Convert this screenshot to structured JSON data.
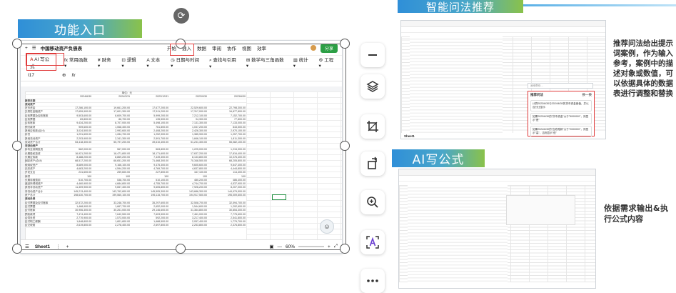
{
  "banners": {
    "function_entry": "功能入口",
    "smart_recommend": "智能问法推荐",
    "ai_formula": "AI写公式"
  },
  "main_window": {
    "title_plus": "+",
    "doc_title": "中国移动资产负债表",
    "menu_tabs": [
      "开始",
      "插入",
      "数据",
      "审阅",
      "协作",
      "视图",
      "效率"
    ],
    "highlighted_tab_index": 3,
    "share_label": "分享",
    "toolbar": {
      "ai_formula": "AI 写公式",
      "common_functions": "常用函数",
      "finance": "财务",
      "logic": "逻辑",
      "text": "文本",
      "datetime": "日期与时间",
      "lookup": "查找与引用",
      "math": "数学与三角函数",
      "stats": "统计",
      "engineering": "工程"
    },
    "cell_ref": "I17",
    "fx_label": "fx",
    "table": {
      "unit": "单位：元",
      "headers": [
        "",
        "2024/6/30",
        "2024/3/31",
        "2023/12/31",
        "2023/9/30",
        "2023/6/30"
      ],
      "rows": [
        [
          "报表日期",
          "",
          "",
          "",
          "",
          ""
        ],
        [
          "流动资产",
          "",
          "",
          "",
          "",
          ""
        ],
        [
          "货币资金",
          "17,286,100.00",
          "19,661,200.00",
          "17,677,200.00",
          "22,529,600.00",
          "22,798,300.00"
        ],
        [
          "交易性金融资产",
          "17,659,900.00",
          "17,601,300.00",
          "17,511,200.00",
          "17,317,000.00",
          "16,877,800.00"
        ],
        [
          "应收票据及应收账款",
          "9,503,600.00",
          "8,609,700.00",
          "5,999,200.00",
          "7,212,100.00",
          "7,152,700.00"
        ],
        [
          "应收票据",
          "69,800.00",
          "86,700.00",
          "135,500.00",
          "94,300.00",
          "77,800.00"
        ],
        [
          "应收账款",
          "9,434,200.00",
          "8,707,000.00",
          "5,498,100.00",
          "7,131,300.00",
          "7,133,000.00"
        ],
        [
          "预付款项",
          "909,600.00",
          "1,068,400.00",
          "761,800.00",
          "1,037,200.00",
          "843,500.00"
        ],
        [
          "其他应收款(合计)",
          "3,024,500.00",
          "2,993,600.00",
          "2,408,200.00",
          "2,426,300.00",
          "2,970,100.00"
        ],
        [
          "存货",
          "1,291,600.00",
          "1,284,700.00",
          "1,252,900.00",
          "1,385,900.00",
          "1,257,700.00"
        ],
        [
          "其他流动资产",
          "2,203,900.00",
          "2,341,300.00",
          "2,591,700.00",
          "1,846,100.00",
          "1,811,300.00"
        ],
        [
          "流动资产合计",
          "53,418,300.00",
          "55,797,200.00",
          "49,610,400.00",
          "51,231,300.00",
          "55,082,100.00"
        ],
        [
          "非流动资产",
          "",
          "",
          "",
          "",
          ""
        ],
        [
          "持有至到期投资",
          "582,000.00",
          "567,000.00",
          "563,800.00",
          "1,225,000.00",
          "1,215,300.00"
        ],
        [
          "长期股权投资",
          "16,921,200.00",
          "18,471,800.00",
          "18,171,600.00",
          "17,637,200.00",
          "17,816,400.00"
        ],
        [
          "长期应收款",
          "8,488,200.00",
          "8,869,200.00",
          "7,449,300.00",
          "8,133,800.00",
          "10,076,400.00"
        ],
        [
          "固定资产(合计)",
          "68,517,200.00",
          "68,651,200.00",
          "71,468,300.00",
          "70,348,500.00",
          "68,205,800.00"
        ],
        [
          "使用权资产",
          "8,689,000.00",
          "9,166,100.00",
          "9,475,300.00",
          "9,605,600.00",
          "9,647,400.00"
        ],
        [
          "无形资产",
          "4,683,200.00",
          "4,594,200.00",
          "4,769,700.00",
          "4,637,800.00",
          "4,444,800.00"
        ],
        [
          "开发支出",
          "231,600.00",
          "259,600.00",
          "227,800.00",
          "167,100.00",
          "114,400.00"
        ],
        [
          "商誉",
          "100",
          "100",
          "100",
          "100",
          "100"
        ],
        [
          "长期待摊费用",
          "510,700.00",
          "538,700.00",
          "510,100.00",
          "480,200.00",
          "486,400.00"
        ],
        [
          "递延所得税资产",
          "4,460,900.00",
          "4,684,800.00",
          "4,755,700.00",
          "4,744,700.00",
          "4,537,900.00"
        ],
        [
          "其他非流动资产",
          "11,309,900.00",
          "9,657,400.00",
          "9,605,800.00",
          "7,926,200.00",
          "8,207,000.00"
        ],
        [
          "非流动资产合计",
          "145,213,400.00",
          "143,762,800.00",
          "145,505,300.00",
          "143,686,300.00",
          "144,979,500.00"
        ],
        [
          "资产总计",
          "198,630,700.00",
          "199,560,100.00",
          "195,115,700.00",
          "194,917,500.00",
          "195,009,600.00"
        ],
        [
          "流动负债",
          "",
          "",
          "",
          "",
          ""
        ],
        [
          "应付票据及应付账款",
          "32,572,200.00",
          "33,248,700.00",
          "35,297,600.00",
          "32,508,700.00",
          "32,594,700.00"
        ],
        [
          "应付票据",
          "1,468,900.00",
          "1,667,700.00",
          "2,652,000.00",
          "1,544,600.00",
          "1,292,600.00"
        ],
        [
          "应付账款",
          "30,906,300.00",
          "30,261,000.00",
          "29,146,600.00",
          "31,364,800.00",
          "30,854,300.00"
        ],
        [
          "预收款项",
          "7,474,400.00",
          "7,642,500.00",
          "7,603,500.00",
          "7,461,000.00",
          "7,775,600.00"
        ],
        [
          "合同负债",
          "2,770,900.00",
          "1,573,000.00",
          "592,200.00",
          "3,217,400.00",
          "2,541,800.00"
        ],
        [
          "应付职工薪酬",
          "1,848,800.00",
          "1,801,800.00",
          "1,688,500.00",
          "2,057,400.00",
          "1,779,700.00"
        ],
        [
          "应交税费",
          "2,619,800.00",
          "2,278,400.00",
          "2,697,800.00",
          "2,253,800.00",
          "2,376,800.00"
        ]
      ]
    },
    "status": {
      "sheet_tab": "Sheet1",
      "zoom": "60%",
      "minus": "—",
      "plus": "+"
    }
  },
  "thumbnail_top": {
    "sheet_tab": "Sheet1",
    "assist_placeholder": "我来帮你…",
    "popup_title": "推荐问法",
    "popup_refresh": "换一换",
    "suggestions": [
      "计算2023/6/30与2024/6/30的货币资金差值，并以百分比显示",
      "如果2023/6/30的\"货币资金\"大于\"5000000\"，则显示\"是\"",
      "如果2024/6/30的\"应收账款\"大于\"2000000\"，则显示\"高\"，否则显示\"低\""
    ]
  },
  "thumbnail_bottom": {
    "sheet_tab": "Sheet1"
  },
  "captions": {
    "recommend": "推荐问法给出提示词案例，作为输入参考，案例中的描述对象或数值，可以依据具体的数据表进行调整和替换",
    "formula": "依据需求输出&执行公式内容"
  }
}
